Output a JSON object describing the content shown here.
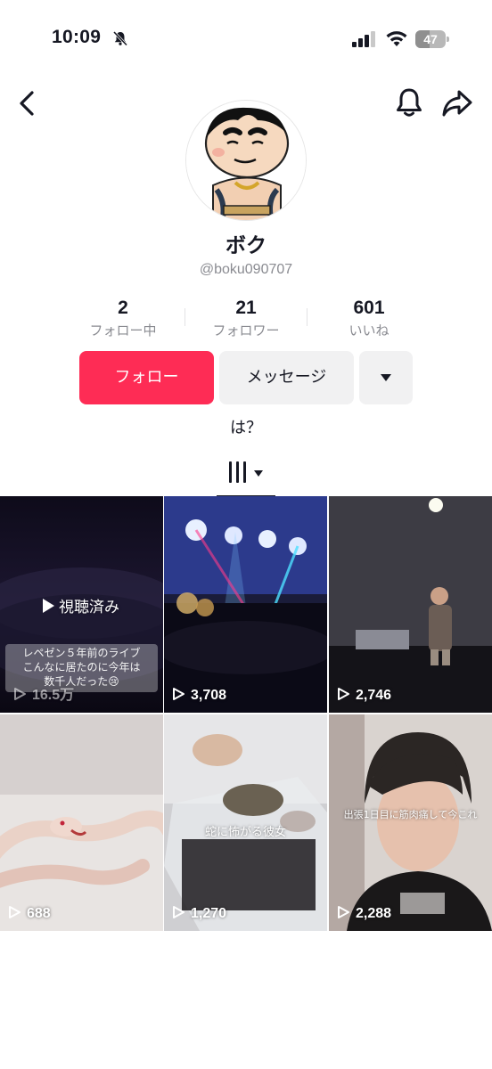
{
  "status_bar": {
    "time": "10:09",
    "battery": "47"
  },
  "profile": {
    "display_name": "ボク",
    "username": "@boku090707",
    "bio": "は？"
  },
  "stats": [
    {
      "value": "2",
      "label": "フォロー中"
    },
    {
      "value": "21",
      "label": "フォロワー"
    },
    {
      "value": "601",
      "label": "いいね"
    }
  ],
  "actions": {
    "follow": "フォロー",
    "message": "メッセージ"
  },
  "videos": [
    {
      "views": "16.5万",
      "overlay": "視聴済み",
      "caption_line1": "レペゼン５年前のライブ",
      "caption_line2": "こんなに居たのに今年は",
      "caption_line3": "数千人だった😢"
    },
    {
      "views": "3,708"
    },
    {
      "views": "2,746"
    },
    {
      "views": "688"
    },
    {
      "views": "1,270",
      "caption": "蛇に怖がる彼女"
    },
    {
      "views": "2,288",
      "caption": "出張1日目に筋肉痛して今これ"
    }
  ],
  "colors": {
    "accent": "#fe2c55",
    "secondary_bg": "#f1f1f2",
    "muted_text": "#8a8b91"
  }
}
